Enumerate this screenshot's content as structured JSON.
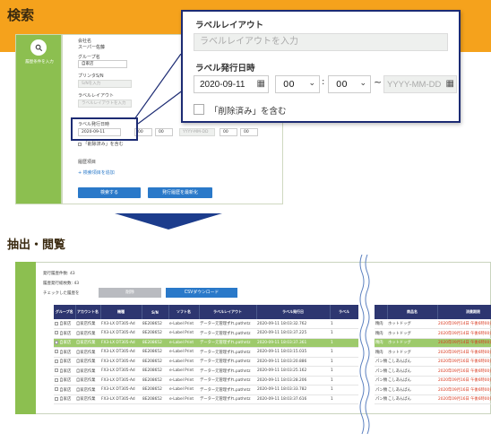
{
  "search_section": {
    "title": "検索",
    "nav_label": "履歴条件を入力",
    "fields": {
      "company_label": "会社名",
      "company_value": "スーパー佐藤",
      "group_label": "グループ名",
      "group_value": "自家店",
      "printer_label": "プリンタS/N",
      "printer_placeholder": "S/Nを入力",
      "layout_label": "ラベルレイアウト",
      "layout_placeholder": "ラベルレイアウトを入力",
      "date_label": "ラベル発行日時",
      "date_value": "2020-09-11",
      "hour_value": "00",
      "minute_value": "00",
      "date_to_placeholder": "YYYY-MM-DD",
      "deleted_label": "「削除済み」を含む",
      "history_label": "履歴項目",
      "add_condition": "+ 検索項目を追加",
      "search_button": "検索する",
      "update_button": "発行履歴を最新化"
    },
    "zoom": {
      "layout_label": "ラベルレイアウト",
      "layout_placeholder": "ラベルレイアウトを入力",
      "date_label": "ラベル発行日時",
      "date_value": "2020-09-11",
      "hour_value": "00",
      "minute_value": "00",
      "tilde": "~",
      "date_to_placeholder": "YYYY-MM-DD",
      "deleted_label": "「削除済み」を含む"
    }
  },
  "browse_section": {
    "title": "抽出・閲覧",
    "issue_count": "発行履歴件数: 43",
    "print_count": "履歴発行総枚数: 43",
    "checked_label": "チェックした履歴を",
    "delete_button": "削除",
    "csv_button": "CSVダウンロード",
    "columns_left": [
      "グループ名",
      "アカウント名",
      "機種",
      "S/N",
      "ソフト名",
      "ラベルレイアウト",
      "ラベル発行日",
      "ラベル"
    ],
    "columns_right": [
      "商品名",
      "消費期限"
    ],
    "rows": [
      {
        "group": "自家店",
        "account": "自家店作業",
        "model": "FX3-LX DT305-Ad",
        "sn": "8E208652",
        "soft": "e-Label Print",
        "layout": "データー元管理ずれ.pathntz",
        "date": "2020-09-11 18:03:32.762",
        "num": "1",
        "cat": "精肉",
        "item": "ホットドッグ",
        "expiry": "2020年09月14日 午後6時00分"
      },
      {
        "group": "自家店",
        "account": "自家店作業",
        "model": "FX3-LX DT305-Ad",
        "sn": "8E208652",
        "soft": "e-Label Print",
        "layout": "データー元管理ずれ.pathntz",
        "date": "2020-09-11 18:03:37.225",
        "num": "1",
        "cat": "精肉",
        "item": "ホットドッグ",
        "expiry": "2020年09月14日 午後6時00分"
      },
      {
        "group": "自家店",
        "account": "自家店作業",
        "model": "FX3-LX DT305-Ad",
        "sn": "8E208652",
        "soft": "e-Label Print",
        "layout": "データー元管理ずれ.pathntz",
        "date": "2020-09-11 18:03:37.361",
        "num": "1",
        "cat": "精肉",
        "item": "ホットドッグ",
        "expiry": "2020年09月14日 午後6時00分"
      },
      {
        "group": "自家店",
        "account": "自家店作業",
        "model": "FX3-LX DT305-Ad",
        "sn": "8E208652",
        "soft": "e-Label Print",
        "layout": "データー元管理ずれ.pathntz",
        "date": "2020-09-11 18:03:15.035",
        "num": "1",
        "cat": "精肉",
        "item": "ホットドッグ",
        "expiry": "2020年09月14日 午後6時00分"
      },
      {
        "group": "自家店",
        "account": "自家店作業",
        "model": "FX3-LX DT305-Ad",
        "sn": "8E208652",
        "soft": "e-Label Print",
        "layout": "データー元管理ずれ.pathntz",
        "date": "2020-09-11 18:03:20.886",
        "num": "1",
        "cat": "パン類",
        "item": "こしあんぱん",
        "expiry": "2020年09月16日 午後6時00分"
      },
      {
        "group": "自家店",
        "account": "自家店作業",
        "model": "FX3-LX DT305-Ad",
        "sn": "8E208652",
        "soft": "e-Label Print",
        "layout": "データー元管理ずれ.pathntz",
        "date": "2020-09-11 18:03:25.162",
        "num": "1",
        "cat": "パン類",
        "item": "こしあんぱん",
        "expiry": "2020年09月16日 午後6時00分"
      },
      {
        "group": "自家店",
        "account": "自家店作業",
        "model": "FX3-LX DT305-Ad",
        "sn": "8E208652",
        "soft": "e-Label Print",
        "layout": "データー元管理ずれ.pathntz",
        "date": "2020-09-11 18:03:28.206",
        "num": "1",
        "cat": "パン類",
        "item": "こしあんぱん",
        "expiry": "2020年09月16日 午後6時00分"
      },
      {
        "group": "自家店",
        "account": "自家店作業",
        "model": "FX3-LX DT305-Ad",
        "sn": "8E208652",
        "soft": "e-Label Print",
        "layout": "データー元管理ずれ.pathntz",
        "date": "2020-09-11 18:03:33.782",
        "num": "1",
        "cat": "パン類",
        "item": "こしあんぱん",
        "expiry": "2020年09月16日 午後6時00分"
      },
      {
        "group": "自家店",
        "account": "自家店作業",
        "model": "FX3-LX DT305-Ad",
        "sn": "8E208652",
        "soft": "e-Label Print",
        "layout": "データー元管理ずれ.pathntz",
        "date": "2020-09-11 18:03:37.616",
        "num": "1",
        "cat": "パン類",
        "item": "こしあんぱん",
        "expiry": "2020年09月16日 午後6時00分"
      }
    ],
    "highlighted_row": 2
  },
  "colors": {
    "orange": "#f5a21c",
    "green": "#8cbf50",
    "navy": "#1c2b73",
    "blue_button": "#2a79c9",
    "expiry_red": "#d9381e"
  }
}
